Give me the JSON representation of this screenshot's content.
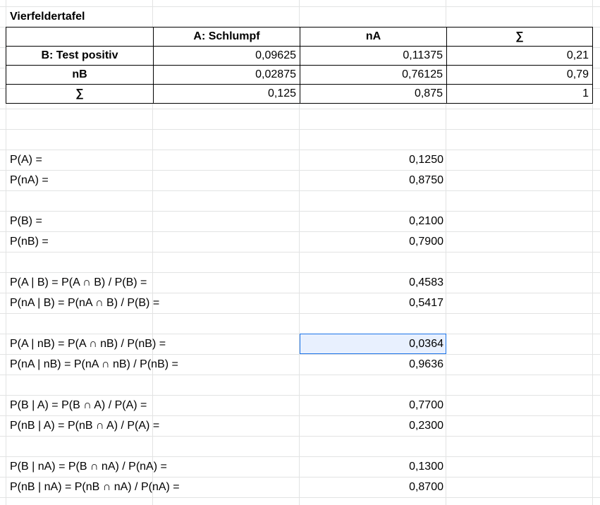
{
  "sheet": {
    "title": "Vierfeldertafel",
    "table": {
      "header": [
        "",
        "A: Schlumpf",
        "nA",
        "∑"
      ],
      "rows": [
        [
          "B: Test positiv",
          "0,09625",
          "0,11375",
          "0,21"
        ],
        [
          "nB",
          "0,02875",
          "0,76125",
          "0,79"
        ],
        [
          "∑",
          "0,125",
          "0,875",
          "1"
        ]
      ]
    },
    "probabilities": [
      {
        "label": "P(A) =",
        "value": "0,1250"
      },
      {
        "label": "P(nA) =",
        "value": "0,8750"
      },
      {
        "label": "P(B) =",
        "value": "0,2100"
      },
      {
        "label": "P(nB) =",
        "value": "0,7900"
      },
      {
        "label": "P(A | B) = P(A ∩ B) / P(B) =",
        "value": "0,4583"
      },
      {
        "label": "P(nA | B) = P(nA ∩ B) / P(B) =",
        "value": "0,5417"
      },
      {
        "label": "P(A | nB) = P(A ∩ nB) / P(nB) =",
        "value": "0,0364"
      },
      {
        "label": "P(nA | nB) = P(nA ∩ nB) / P(nB) =",
        "value": "0,9636"
      },
      {
        "label": "P(B | A) = P(B ∩ A) / P(A) =",
        "value": "0,7700"
      },
      {
        "label": "P(nB | A) = P(nB ∩ A) / P(A) =",
        "value": "0,2300"
      },
      {
        "label": "P(B | nA) = P(B ∩ nA) / P(nA) =",
        "value": "0,1300"
      },
      {
        "label": "P(nB | nA) = P(nB ∩ nA) / P(nA) =",
        "value": "0,8700"
      }
    ]
  }
}
